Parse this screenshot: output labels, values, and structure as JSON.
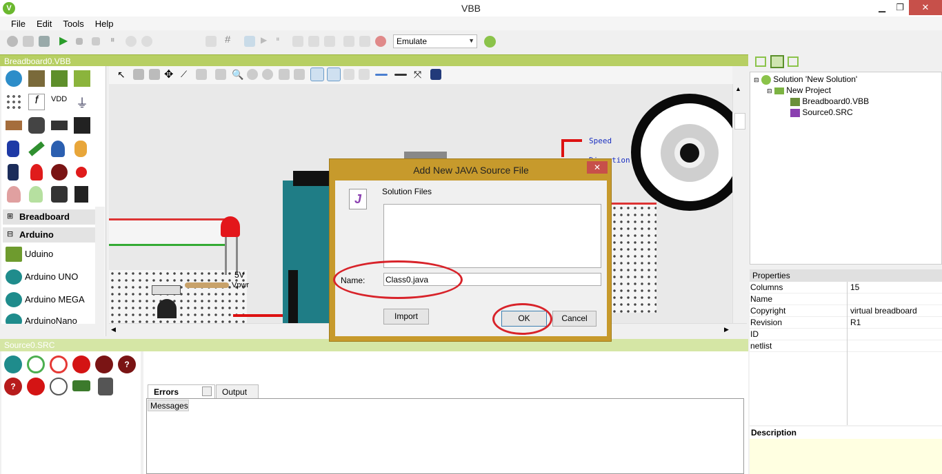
{
  "window": {
    "title": "VBB",
    "minimize": "▁",
    "maximize": "❐",
    "close": "✕"
  },
  "menu": [
    "File",
    "Edit",
    "Tools",
    "Help"
  ],
  "toolbar": {
    "mode_value": "Emulate"
  },
  "breadboard_panel": {
    "title": "Breadboard0.VBB",
    "groups": [
      "Breadboard",
      "Arduino"
    ],
    "arduino_items": [
      "Uduino",
      "Arduino UNO",
      "Arduino MEGA",
      "ArduinoNano"
    ],
    "vdd_label": "VDD",
    "canvas_labels": {
      "speed": "Speed",
      "direction": "Direction",
      "fv": "5V",
      "vpwr": "Vpwr"
    }
  },
  "solution_tree": {
    "solution": "Solution 'New Solution'",
    "project": "New Project",
    "files": [
      "Breadboard0.VBB",
      "Source0.SRC"
    ]
  },
  "properties": {
    "header": "Properties",
    "rows": [
      {
        "name": "Columns",
        "value": "15"
      },
      {
        "name": "Name",
        "value": ""
      },
      {
        "name": "Copyright",
        "value": "virtual breadboard"
      },
      {
        "name": "Revision",
        "value": "R1"
      },
      {
        "name": "ID",
        "value": ""
      },
      {
        "name": "netlist",
        "value": ""
      }
    ],
    "description_header": "Description"
  },
  "source_panel": {
    "title": "Source0.SRC",
    "tabs": [
      "Errors",
      "Output"
    ],
    "messages_label": "Messages"
  },
  "dialog": {
    "title": "Add New JAVA Source File",
    "close": "✕",
    "solution_files_label": "Solution Files",
    "name_label": "Name:",
    "name_value": "Class0.java",
    "import_label": "Import",
    "ok_label": "OK",
    "cancel_label": "Cancel"
  },
  "colors": {
    "accent_green": "#b7cf63",
    "dialog_frame": "#c79a2c",
    "annotation_red": "#d8232a"
  }
}
